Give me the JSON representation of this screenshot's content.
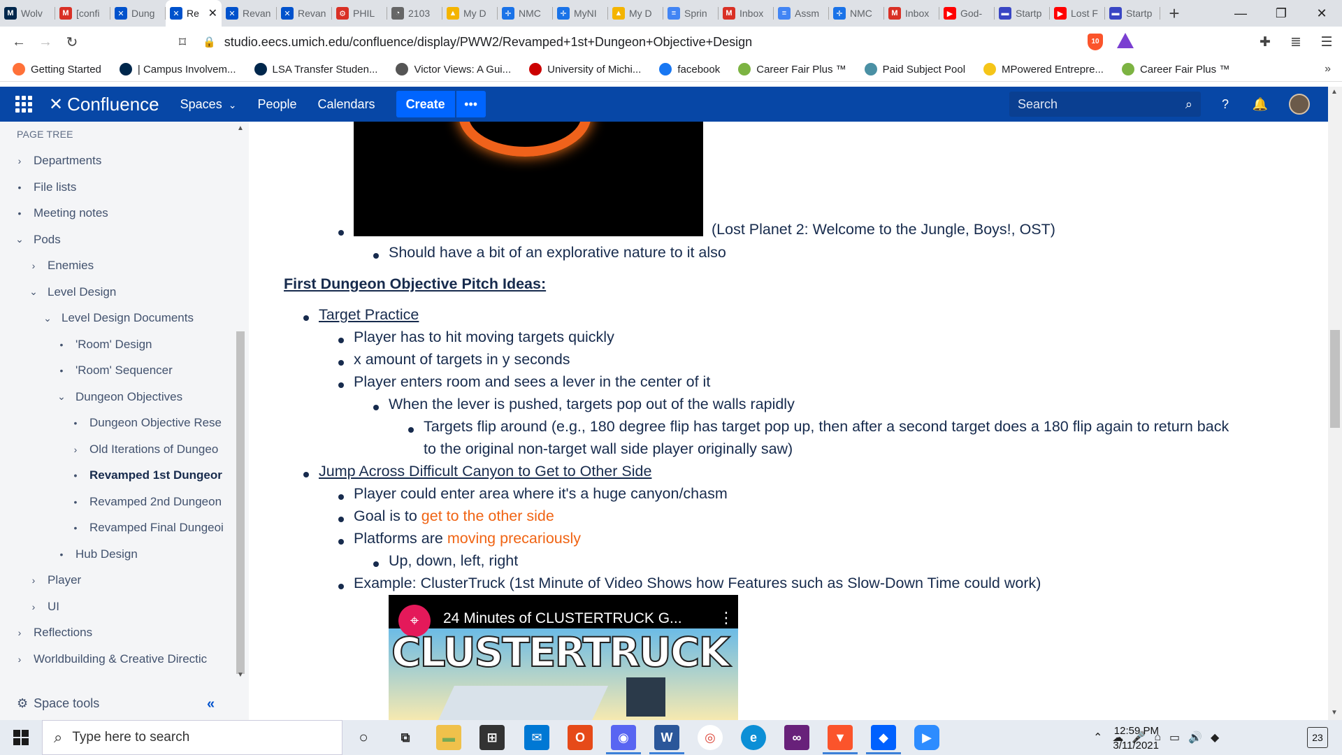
{
  "browser": {
    "tabs": [
      {
        "label": "Wolv",
        "icon": "M",
        "color": "#00274c"
      },
      {
        "label": "[confi",
        "icon": "M",
        "color": "#d93025"
      },
      {
        "label": "Dung",
        "icon": "✕",
        "color": "#0052cc"
      },
      {
        "label": "Re",
        "icon": "✕",
        "color": "#0052cc",
        "active": true
      },
      {
        "label": "Revan",
        "icon": "✕",
        "color": "#0052cc"
      },
      {
        "label": "Revan",
        "icon": "✕",
        "color": "#0052cc"
      },
      {
        "label": "PHIL",
        "icon": "⚙",
        "color": "#d93025"
      },
      {
        "label": "2103",
        "icon": "◔",
        "color": "#666"
      },
      {
        "label": "My D",
        "icon": "▲",
        "color": "#f4b400"
      },
      {
        "label": "NMC",
        "icon": "✛",
        "color": "#1a73e8"
      },
      {
        "label": "MyNI",
        "icon": "✛",
        "color": "#1a73e8"
      },
      {
        "label": "My D",
        "icon": "▲",
        "color": "#f4b400"
      },
      {
        "label": "Sprin",
        "icon": "≡",
        "color": "#4285f4"
      },
      {
        "label": "Inbox",
        "icon": "M",
        "color": "#d93025"
      },
      {
        "label": "Assm",
        "icon": "≡",
        "color": "#4285f4"
      },
      {
        "label": "NMC",
        "icon": "✛",
        "color": "#1a73e8"
      },
      {
        "label": "Inbox",
        "icon": "M",
        "color": "#d93025"
      },
      {
        "label": "God-",
        "icon": "▶",
        "color": "#ff0000"
      },
      {
        "label": "Startp",
        "icon": "▬",
        "color": "#3946c4"
      },
      {
        "label": "Lost F",
        "icon": "▶",
        "color": "#ff0000"
      },
      {
        "label": "Startp",
        "icon": "▬",
        "color": "#3946c4"
      }
    ],
    "new_tab": "+",
    "url": "studio.eecs.umich.edu/confluence/display/PWW2/Revamped+1st+Dungeon+Objective+Design",
    "brave_badge": "10",
    "bookmarks": [
      {
        "label": "Getting Started",
        "icon": "firefox-icon",
        "color": "#ff7139"
      },
      {
        "label": "| Campus Involvem...",
        "icon": "umich-icon",
        "color": "#00274c"
      },
      {
        "label": "LSA Transfer Studen...",
        "icon": "lsa-icon",
        "color": "#00274c"
      },
      {
        "label": "Victor Views: A Gui...",
        "icon": "globe-icon",
        "color": "#555"
      },
      {
        "label": "University of Michi...",
        "icon": "sp-icon",
        "color": "#c00"
      },
      {
        "label": "facebook",
        "icon": "facebook-icon",
        "color": "#1877f2"
      },
      {
        "label": "Career Fair Plus ™",
        "icon": "cf-icon",
        "color": "#7cb342"
      },
      {
        "label": "Paid Subject Pool",
        "icon": "pool-icon",
        "color": "#4a90a4"
      },
      {
        "label": "MPowered Entrepre...",
        "icon": "hex-icon",
        "color": "#f5c518"
      },
      {
        "label": "Career Fair Plus ™",
        "icon": "cf-icon",
        "color": "#7cb342"
      }
    ]
  },
  "confluence": {
    "logo": "Confluence",
    "nav": [
      "Spaces",
      "People",
      "Calendars"
    ],
    "spaces_chevron": "⌄",
    "create": "Create",
    "more": "•••",
    "search_placeholder": "Search"
  },
  "sidebar": {
    "title": "PAGE TREE",
    "items": [
      {
        "label": "Departments",
        "mark": "›",
        "indent": 0
      },
      {
        "label": "File lists",
        "mark": "•",
        "indent": 0
      },
      {
        "label": "Meeting notes",
        "mark": "•",
        "indent": 0
      },
      {
        "label": "Pods",
        "mark": "⌄",
        "indent": 0
      },
      {
        "label": "Enemies",
        "mark": "›",
        "indent": 1
      },
      {
        "label": "Level Design",
        "mark": "⌄",
        "indent": 1
      },
      {
        "label": "Level Design Documents",
        "mark": "⌄",
        "indent": 2
      },
      {
        "label": "'Room' Design",
        "mark": "•",
        "indent": 3
      },
      {
        "label": "'Room' Sequencer",
        "mark": "•",
        "indent": 3
      },
      {
        "label": "Dungeon Objectives",
        "mark": "⌄",
        "indent": 3
      },
      {
        "label": "Dungeon Objective Rese",
        "mark": "•",
        "indent": 4
      },
      {
        "label": "Old Iterations of Dungeo",
        "mark": "›",
        "indent": 4
      },
      {
        "label": "Revamped 1st Dungeor",
        "mark": "•",
        "indent": 4,
        "bold": true
      },
      {
        "label": "Revamped 2nd Dungeon",
        "mark": "•",
        "indent": 4
      },
      {
        "label": "Revamped Final Dungeoi",
        "mark": "•",
        "indent": 4
      },
      {
        "label": "Hub Design",
        "mark": "•",
        "indent": 3
      },
      {
        "label": "Player",
        "mark": "›",
        "indent": 1
      },
      {
        "label": "UI",
        "mark": "›",
        "indent": 1
      },
      {
        "label": "Reflections",
        "mark": "›",
        "indent": 0
      },
      {
        "label": "Worldbuilding & Creative Directic",
        "mark": "›",
        "indent": 0
      }
    ],
    "space_tools": "Space tools",
    "collapse": "«"
  },
  "content": {
    "img_caption": "(Lost Planet 2: Welcome to the Jungle, Boys!, OST)",
    "explorative": "Should have a bit of an explorative nature to it also",
    "heading": "First Dungeon Objective Pitch Ideas:",
    "target_practice": "Target Practice",
    "tp_1": "Player has to hit moving targets quickly",
    "tp_2": "x amount of targets in y seconds",
    "tp_3": "Player enters room and sees a lever in the center of it",
    "tp_3a": "When the lever is pushed, targets pop out of the walls rapidly",
    "tp_3a_i_line1": "Targets flip around (e.g., 180 degree flip has target pop up, then after a second target does a 180 flip again to return back",
    "tp_3a_i_line2": "to the original non-target wall side player originally saw)",
    "jump": "Jump Across Difficult Canyon to Get to Other Side",
    "j_1": "Player could enter area where it's a huge canyon/chasm",
    "j_2_pre": "Goal is to ",
    "j_2_hl": "get to the other side",
    "j_3_pre": "Platforms are ",
    "j_3_hl": "moving precariously",
    "j_3a": "Up, down, left, right",
    "j_4": "Example: ClusterTruck (1st Minute of Video Shows how Features such as Slow-Down Time could work)",
    "video_title": "24 Minutes of CLUSTERTRUCK G...",
    "video_big": "CLUSTERTRUCK"
  },
  "taskbar": {
    "search_placeholder": "Type here to search",
    "time": "12:59 PM",
    "date": "3/11/2021",
    "notif_count": "23"
  }
}
